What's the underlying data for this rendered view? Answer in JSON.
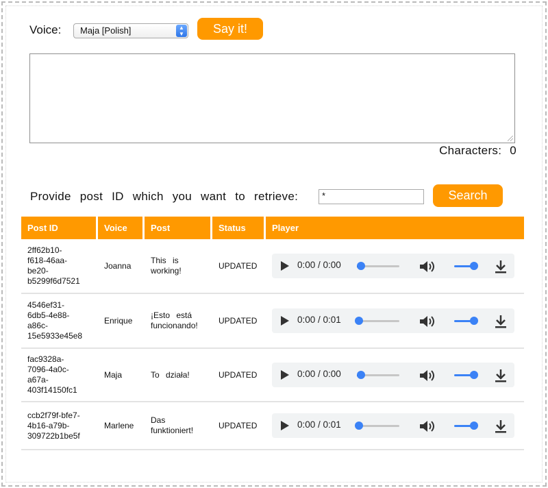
{
  "header": {
    "voice_label": "Voice:",
    "voice_selected": "Maja [Polish]",
    "say_button": "Say it!"
  },
  "editor": {
    "text": "",
    "characters_label": "Characters:",
    "characters_count": "0"
  },
  "retrieve": {
    "label": "Provide post ID which you want to retrieve:",
    "input_value": "*",
    "search_button": "Search"
  },
  "table": {
    "columns": [
      "Post ID",
      "Voice",
      "Post",
      "Status",
      "Player"
    ],
    "rows": [
      {
        "id_lines": [
          "2ff62b10-",
          "f618-46aa-",
          "be20-",
          "b5299f6d7521"
        ],
        "voice": "Joanna",
        "post_lines": [
          "This is",
          "working!"
        ],
        "status": "UPDATED",
        "time": "0:00 / 0:00",
        "progress": 0.05,
        "volume": 1.0
      },
      {
        "id_lines": [
          "4546ef31-",
          "6db5-4e88-",
          "a86c-",
          "15e5933e45e8"
        ],
        "voice": "Enrique",
        "post_lines": [
          "¡Esto está",
          "funcionando!"
        ],
        "status": "UPDATED",
        "time": "0:00 / 0:01",
        "progress": 0.0,
        "volume": 1.0
      },
      {
        "id_lines": [
          "fac9328a-",
          "7096-4a0c-",
          "a67a-",
          "403f14150fc1"
        ],
        "voice": "Maja",
        "post_lines": [
          "To działa!"
        ],
        "status": "UPDATED",
        "time": "0:00 / 0:00",
        "progress": 0.05,
        "volume": 1.0
      },
      {
        "id_lines": [
          "ccb2f79f-bfe7-",
          "4b16-a79b-",
          "309722b1be5f"
        ],
        "voice": "Marlene",
        "post_lines": [
          "Das",
          "funktioniert!"
        ],
        "status": "UPDATED",
        "time": "0:00 / 0:01",
        "progress": 0.0,
        "volume": 1.0
      }
    ]
  },
  "icons": {
    "play": "play-icon",
    "volume": "volume-icon",
    "download": "download-icon",
    "select_arrows": "chevron-updown-icon"
  },
  "colors": {
    "accent": "#ff9900",
    "slider": "#3b82f6",
    "player_bg": "#f1f3f4"
  }
}
